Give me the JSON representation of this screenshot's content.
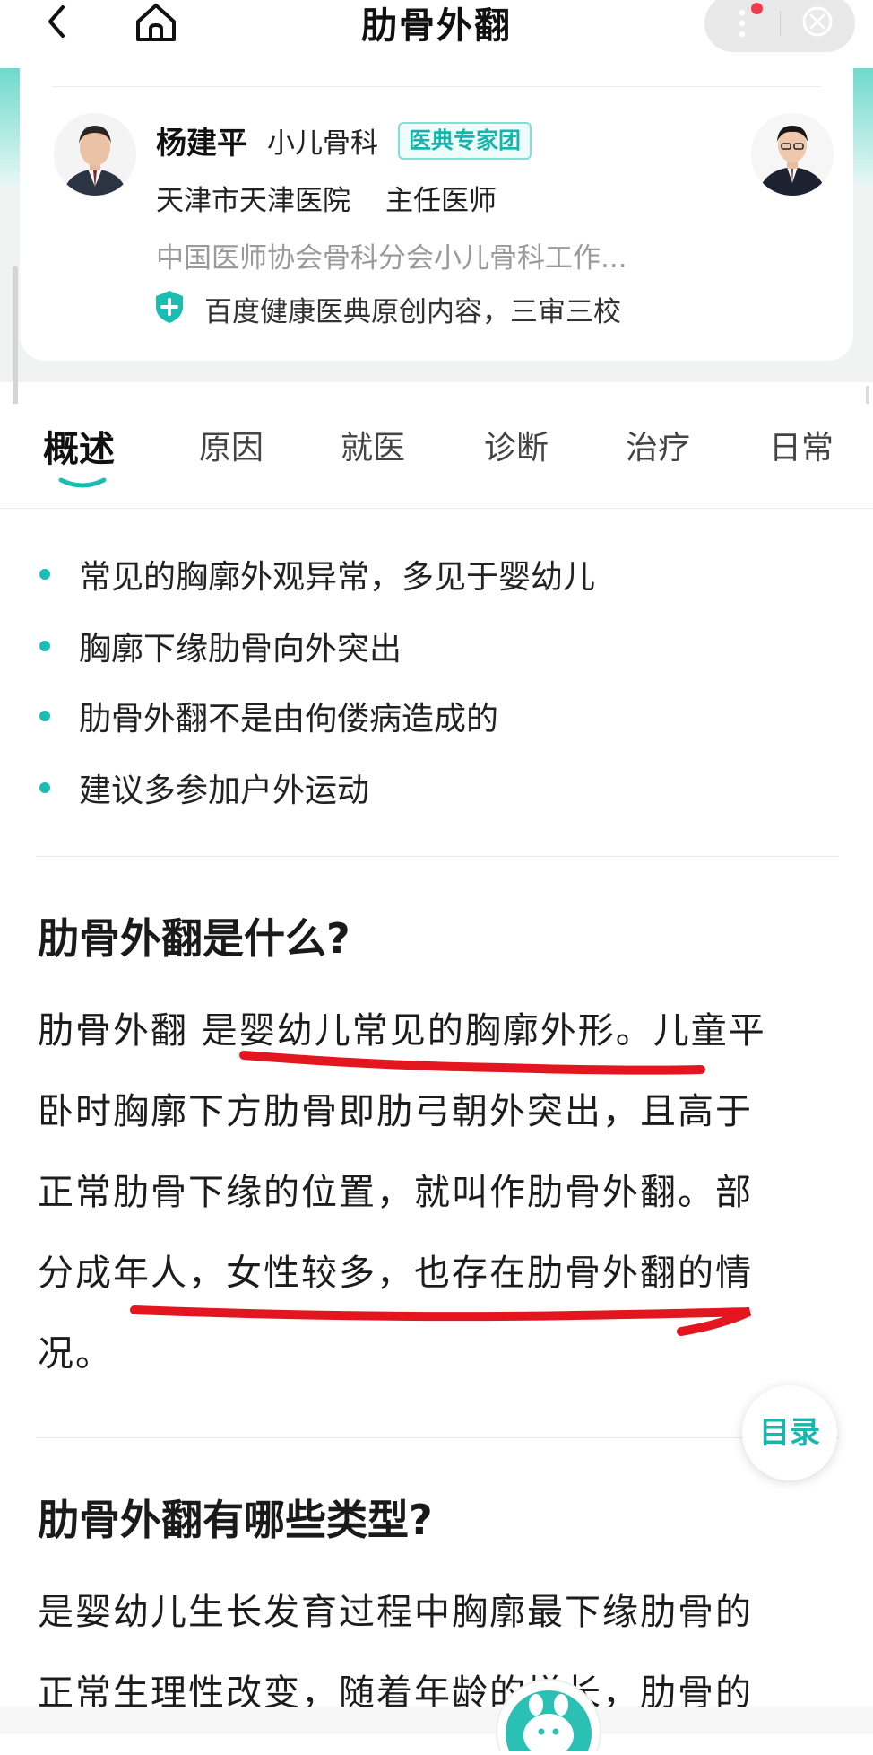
{
  "nav": {
    "title": "肋骨外翻"
  },
  "doctor": {
    "name": "杨建平",
    "department": "小儿骨科",
    "badge": "医典专家团",
    "hospital": "天津市天津医院",
    "title": "主任医师",
    "association": "中国医师协会骨科分会小儿骨科工作...",
    "trust_text": "百度健康医典原创内容，三审三校"
  },
  "tabs": [
    {
      "label": "概述",
      "active": true
    },
    {
      "label": "原因"
    },
    {
      "label": "就医"
    },
    {
      "label": "诊断"
    },
    {
      "label": "治疗"
    },
    {
      "label": "日常"
    }
  ],
  "summary": [
    "常见的胸廓外观异常，多见于婴幼儿",
    "胸廓下缘肋骨向外突出",
    "肋骨外翻不是由佝偻病造成的",
    "建议多参加户外运动"
  ],
  "sections": [
    {
      "heading": "肋骨外翻是什么?",
      "lines": [
        "肋骨外翻 是婴幼儿常见的胸廓外形。儿童平",
        "卧时胸廓下方肋骨即肋弓朝外突出，且高于",
        "正常肋骨下缘的位置，就叫作肋骨外翻。部",
        "分成年人，女性较多，也存在肋骨外翻的情",
        "况。"
      ]
    },
    {
      "heading": "肋骨外翻有哪些类型?",
      "lines": [
        "是婴幼儿生长发育过程中胸廓最下缘肋骨的",
        "正常生理性改变，随着年龄的增长，肋骨的"
      ]
    }
  ],
  "toc_label": "目录",
  "colors": {
    "accent": "#1bbdb3",
    "annotation": "#e3161f",
    "badge_bg": "#effcfa"
  },
  "icons": [
    "back-icon",
    "home-icon",
    "more-icon",
    "close-circle-icon",
    "shield-plus-icon",
    "assistant-icon"
  ]
}
